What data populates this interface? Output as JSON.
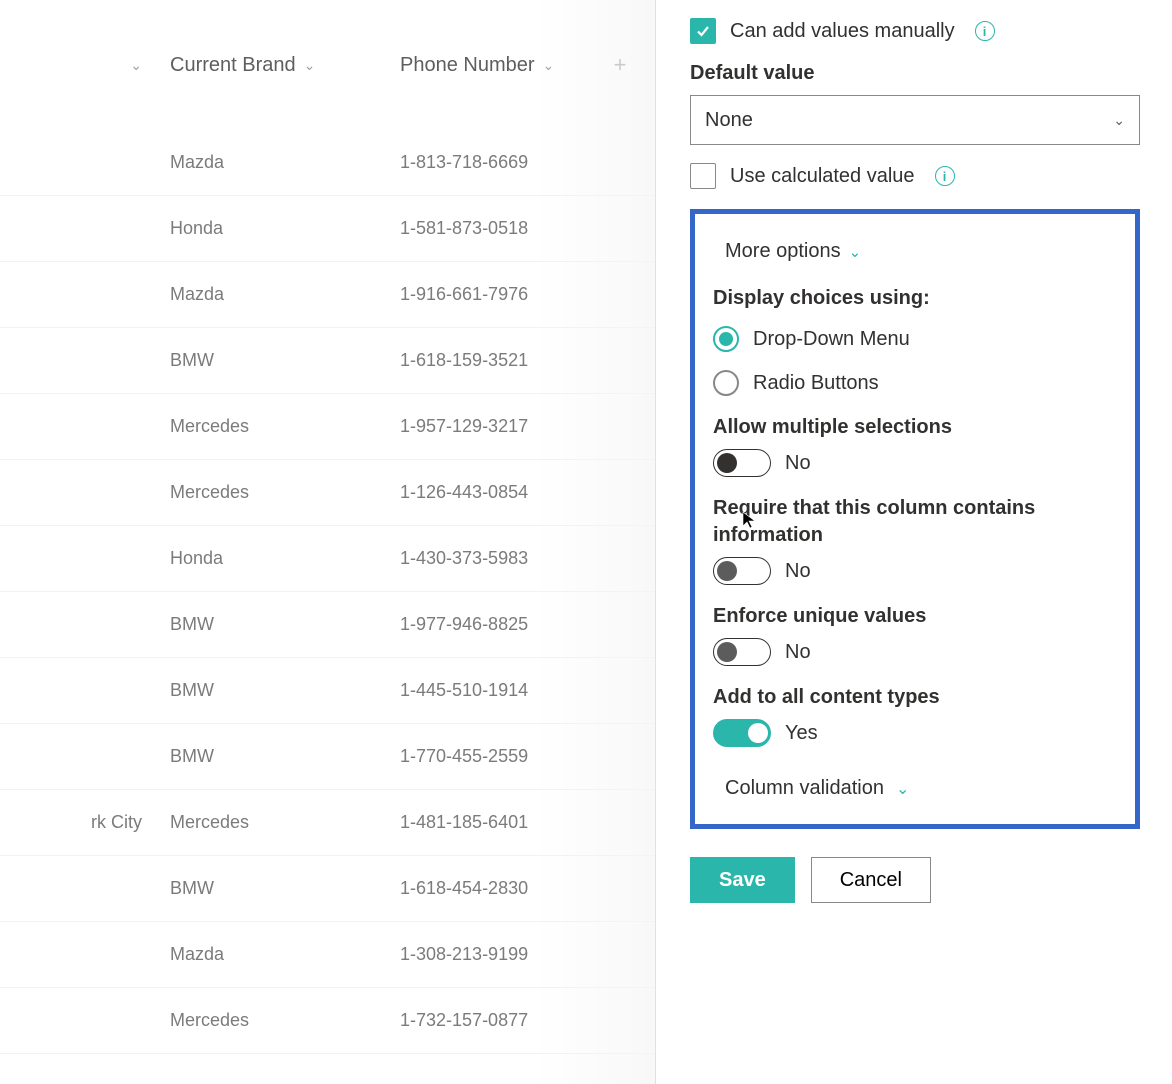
{
  "table": {
    "headers": {
      "col0": "",
      "col1": "Current Brand",
      "col2": "Phone Number"
    },
    "rows": [
      {
        "city": "",
        "brand": "Mazda",
        "phone": "1-813-718-6669"
      },
      {
        "city": "",
        "brand": "Honda",
        "phone": "1-581-873-0518"
      },
      {
        "city": "",
        "brand": "Mazda",
        "phone": "1-916-661-7976"
      },
      {
        "city": "",
        "brand": "BMW",
        "phone": "1-618-159-3521"
      },
      {
        "city": "",
        "brand": "Mercedes",
        "phone": "1-957-129-3217"
      },
      {
        "city": "",
        "brand": "Mercedes",
        "phone": "1-126-443-0854"
      },
      {
        "city": "",
        "brand": "Honda",
        "phone": "1-430-373-5983"
      },
      {
        "city": "",
        "brand": "BMW",
        "phone": "1-977-946-8825"
      },
      {
        "city": "",
        "brand": "BMW",
        "phone": "1-445-510-1914"
      },
      {
        "city": "",
        "brand": "BMW",
        "phone": "1-770-455-2559"
      },
      {
        "city": "rk City",
        "brand": "Mercedes",
        "phone": "1-481-185-6401"
      },
      {
        "city": "",
        "brand": "BMW",
        "phone": "1-618-454-2830"
      },
      {
        "city": "",
        "brand": "Mazda",
        "phone": "1-308-213-9199"
      },
      {
        "city": "",
        "brand": "Mercedes",
        "phone": "1-732-157-0877"
      }
    ]
  },
  "panel": {
    "can_add_manually": {
      "label": "Can add values manually",
      "checked": true
    },
    "default_value": {
      "label": "Default value",
      "value": "None"
    },
    "use_calculated": {
      "label": "Use calculated value",
      "checked": false
    },
    "more_options": {
      "label": "More options"
    },
    "display_choices": {
      "label": "Display choices using:",
      "options": {
        "dropdown": "Drop-Down Menu",
        "radio": "Radio Buttons"
      },
      "selected": "dropdown"
    },
    "allow_multi": {
      "label": "Allow multiple selections",
      "on": false,
      "value": "No"
    },
    "require_info": {
      "label": "Require that this column contains information",
      "on": false,
      "value": "No"
    },
    "enforce_unique": {
      "label": "Enforce unique values",
      "on": false,
      "value": "No"
    },
    "add_all_types": {
      "label": "Add to all content types",
      "on": true,
      "value": "Yes"
    },
    "validation": {
      "label": "Column validation"
    },
    "buttons": {
      "save": "Save",
      "cancel": "Cancel"
    }
  }
}
